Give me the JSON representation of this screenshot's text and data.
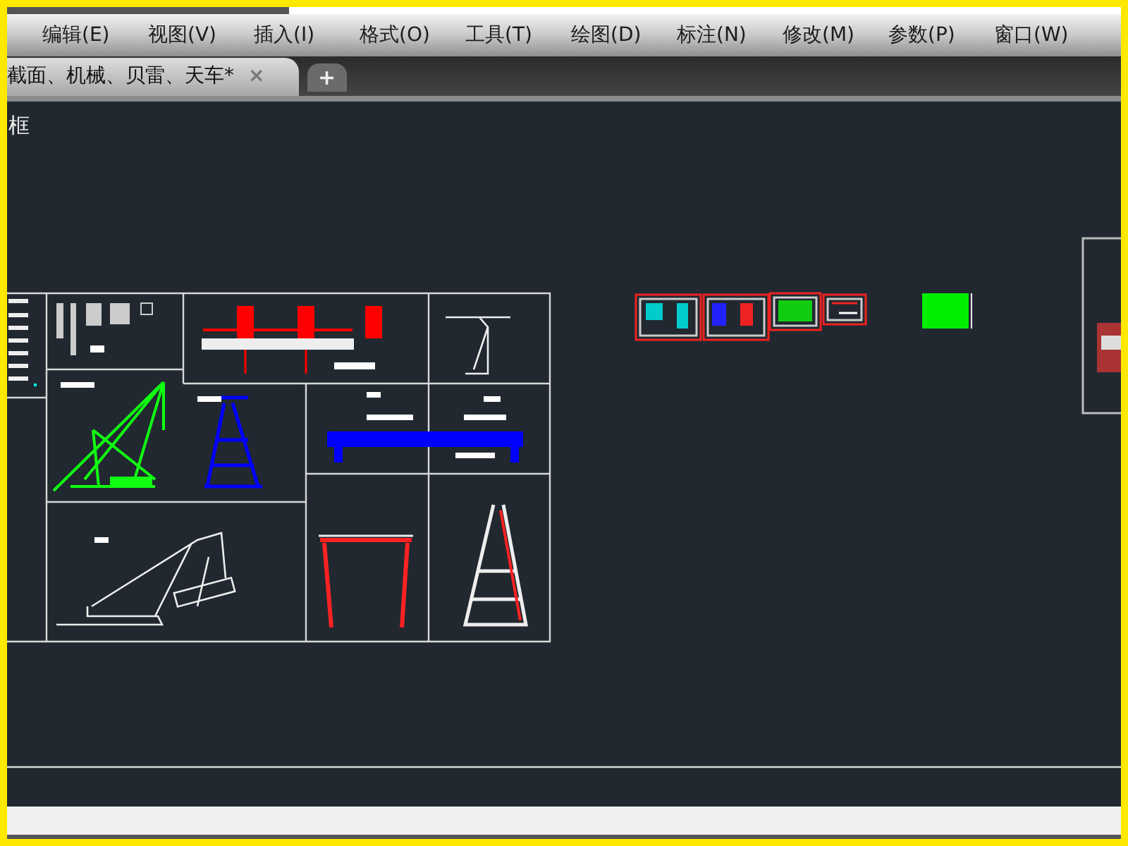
{
  "menu": [
    "编辑(E)",
    "视图(V)",
    "插入(I)",
    "格式(O)",
    "工具(T)",
    "绘图(D)",
    "标注(N)",
    "修改(M)",
    "参数(P)",
    "窗口(W)"
  ],
  "tabs": [
    {
      "label": "截面、机械、贝雷、天车*",
      "close": "×",
      "selected": true
    }
  ],
  "new_tab": "+",
  "viewport_label": "框"
}
